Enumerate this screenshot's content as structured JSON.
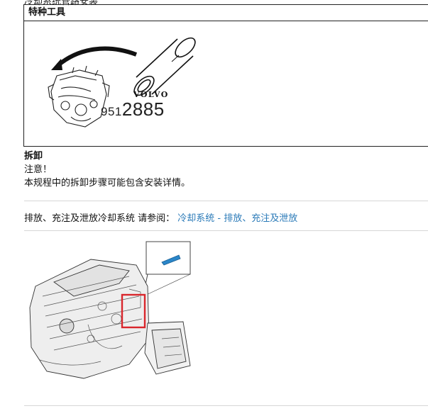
{
  "page": {
    "clipped_top_text": "冷却系统管路安装",
    "tool_header": "特种工具",
    "tool_brand": "VOLVO",
    "tool_number_small": "951",
    "tool_number_large": "2885",
    "section_title": "拆卸",
    "note_label": "注意！",
    "note_text": "本规程中的拆卸步骤可能包含安装详情。",
    "step_text": "排放、充注及泄放冷却系统 请参阅：",
    "step_link": "冷却系统 - 排放、充注及泄放"
  },
  "colors": {
    "link": "#2a7ab8",
    "highlight_box": "#d9262c",
    "callout_part": "#2a86c9"
  }
}
